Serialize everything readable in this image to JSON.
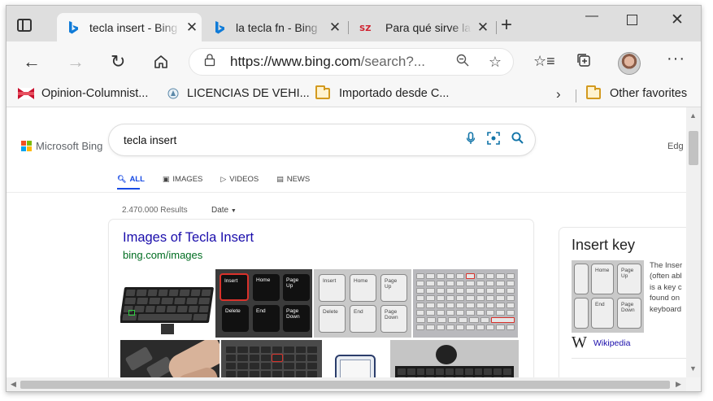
{
  "tabs": [
    {
      "title": "tecla insert - Bing",
      "icon": "bing-icon",
      "active": true
    },
    {
      "title": "la tecla fn - Bing",
      "icon": "bing-icon",
      "active": false
    },
    {
      "title": "Para qué sirve la tecla",
      "icon": "sz-icon",
      "active": false
    }
  ],
  "toolbar": {
    "url_main": "https://www.bing.com",
    "url_rest": "/search?..."
  },
  "favorites": [
    {
      "label": "Opinion-Columnist...",
      "icon": "flag-icon"
    },
    {
      "label": "LICENCIAS DE VEHI...",
      "icon": "site-icon"
    },
    {
      "label": "Importado desde C...",
      "icon": "folder-icon"
    }
  ],
  "favorites_other": "Other favorites",
  "page": {
    "logo_text": "Microsoft Bing",
    "query": "tecla insert",
    "edge_text": "Edg",
    "scopes": [
      {
        "label": "ALL",
        "icon": "search-icon",
        "active": true
      },
      {
        "label": "IMAGES",
        "icon": "image-icon",
        "active": false
      },
      {
        "label": "VIDEOS",
        "icon": "video-icon",
        "active": false
      },
      {
        "label": "NEWS",
        "icon": "news-icon",
        "active": false
      }
    ],
    "result_count": "2.470.000 Results",
    "date_filter": "Date",
    "images_card": {
      "title": "Images of Tecla Insert",
      "url": "bing.com/images"
    },
    "image_keys": {
      "insert": "Insert",
      "home": "Home",
      "page_up": "Page Up",
      "delete": "Delete",
      "end": "End",
      "page_down": "Page Down"
    },
    "knowledge_panel": {
      "title": "Insert key",
      "description_lines": [
        "The Inser",
        "(often abl",
        "is a key c",
        "found on",
        "keyboard"
      ],
      "source": "Wikipedia"
    }
  },
  "colors": {
    "bing_blue": "#174ae4",
    "link_blue": "#1a0dab",
    "url_green": "#006d21",
    "ms_red": "#f25022",
    "ms_green": "#7fba00",
    "ms_blue": "#00a4ef",
    "ms_yellow": "#ffb900"
  }
}
